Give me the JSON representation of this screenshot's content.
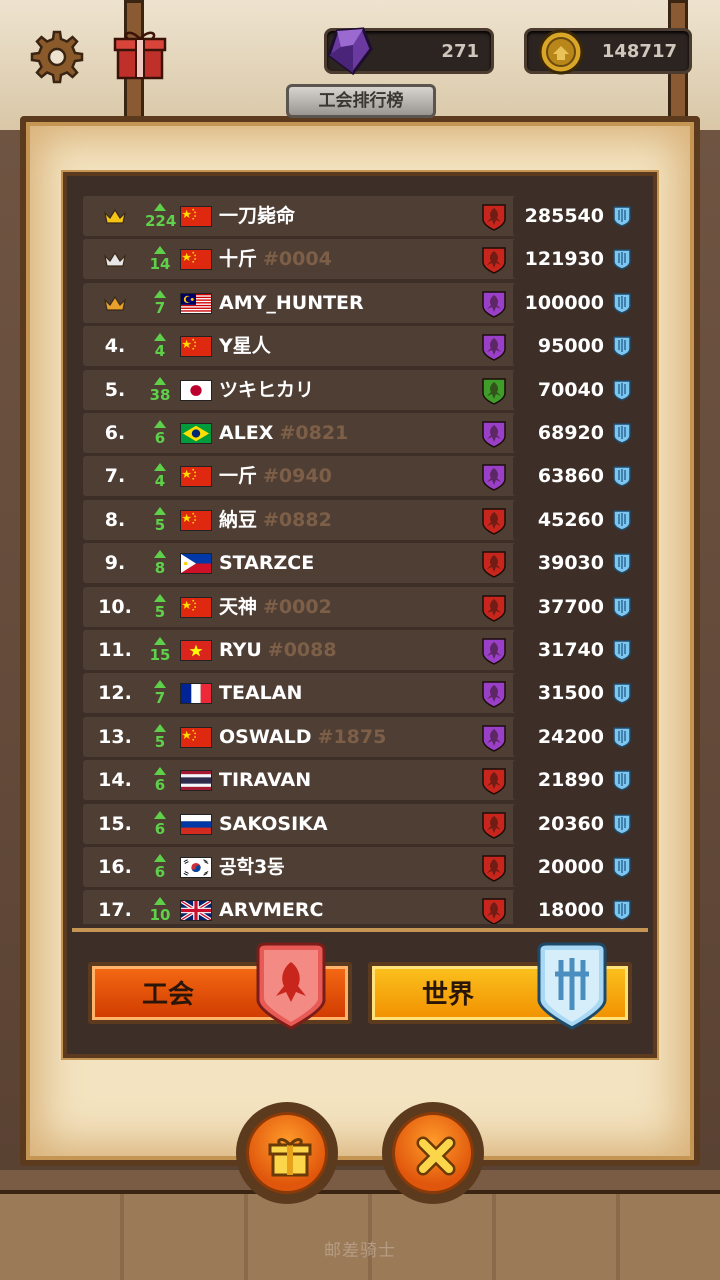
{
  "header": {
    "gems": "271",
    "coins": "148717",
    "title": "工会排行榜"
  },
  "leaderboard": {
    "rows": [
      {
        "rank": "",
        "crown": "gold",
        "level": "224",
        "flag": "cn",
        "name": "一刀毙命",
        "tag": "",
        "emblem": "red",
        "score": "285540"
      },
      {
        "rank": "",
        "crown": "silver",
        "level": "14",
        "flag": "cn",
        "name": "十斤",
        "tag": "#0004",
        "emblem": "red",
        "score": "121930"
      },
      {
        "rank": "",
        "crown": "bronze",
        "level": "7",
        "flag": "my",
        "name": "AMY_HUNTER",
        "tag": "",
        "emblem": "purple",
        "score": "100000"
      },
      {
        "rank": "4.",
        "crown": "",
        "level": "4",
        "flag": "cn",
        "name": "Y星人",
        "tag": "",
        "emblem": "purple",
        "score": "95000"
      },
      {
        "rank": "5.",
        "crown": "",
        "level": "38",
        "flag": "jp",
        "name": "ツキヒカリ",
        "tag": "",
        "emblem": "green",
        "score": "70040"
      },
      {
        "rank": "6.",
        "crown": "",
        "level": "6",
        "flag": "br",
        "name": "ALEX",
        "tag": "#0821",
        "emblem": "purple",
        "score": "68920"
      },
      {
        "rank": "7.",
        "crown": "",
        "level": "4",
        "flag": "cn",
        "name": "一斤",
        "tag": "#0940",
        "emblem": "purple",
        "score": "63860"
      },
      {
        "rank": "8.",
        "crown": "",
        "level": "5",
        "flag": "cn",
        "name": "納豆",
        "tag": "#0882",
        "emblem": "red",
        "score": "45260"
      },
      {
        "rank": "9.",
        "crown": "",
        "level": "8",
        "flag": "ph",
        "name": "STARZCE",
        "tag": "",
        "emblem": "red",
        "score": "39030"
      },
      {
        "rank": "10.",
        "crown": "",
        "level": "5",
        "flag": "cn",
        "name": "天神",
        "tag": "#0002",
        "emblem": "red",
        "score": "37700"
      },
      {
        "rank": "11.",
        "crown": "",
        "level": "15",
        "flag": "vn",
        "name": "RYU",
        "tag": "#0088",
        "emblem": "purple",
        "score": "31740"
      },
      {
        "rank": "12.",
        "crown": "",
        "level": "7",
        "flag": "fr",
        "name": "TEALAN",
        "tag": "",
        "emblem": "purple",
        "score": "31500"
      },
      {
        "rank": "13.",
        "crown": "",
        "level": "5",
        "flag": "cn",
        "name": "OSWALD",
        "tag": "#1875",
        "emblem": "purple",
        "score": "24200"
      },
      {
        "rank": "14.",
        "crown": "",
        "level": "6",
        "flag": "th",
        "name": "TIRAVAN",
        "tag": "",
        "emblem": "red",
        "score": "21890"
      },
      {
        "rank": "15.",
        "crown": "",
        "level": "6",
        "flag": "ru",
        "name": "SAKOSIKA",
        "tag": "",
        "emblem": "red",
        "score": "20360"
      },
      {
        "rank": "16.",
        "crown": "",
        "level": "6",
        "flag": "kr",
        "name": "공학3동",
        "tag": "",
        "emblem": "red",
        "score": "20000"
      },
      {
        "rank": "17.",
        "crown": "",
        "level": "10",
        "flag": "gb",
        "name": "ARVMERC",
        "tag": "",
        "emblem": "red",
        "score": "18000"
      }
    ]
  },
  "tabs": {
    "guild_label": "工会",
    "world_label": "世界"
  },
  "footer": {
    "watermark": "邮差骑士"
  },
  "colors": {
    "level_green": "#5ed04a",
    "tag_brown": "#7d5f48",
    "emblem_red": "#c8261c",
    "emblem_purple": "#9a3fc8",
    "emblem_green": "#3f9e2a",
    "shield_blue": "#7fc6ee"
  }
}
